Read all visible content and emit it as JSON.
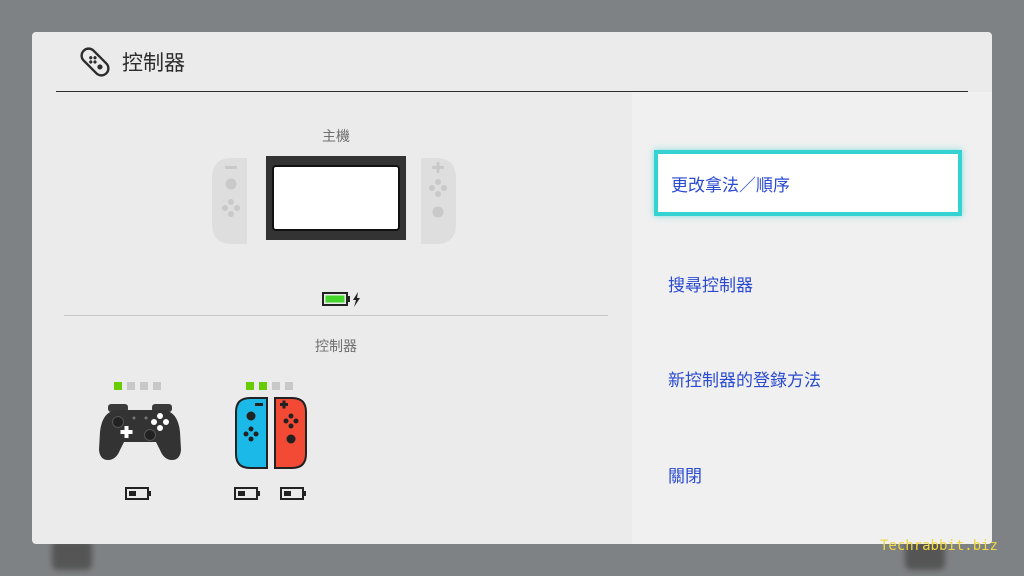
{
  "header": {
    "title": "控制器",
    "icon": "joycon-icon"
  },
  "console_section": {
    "label": "主機",
    "battery": "charging"
  },
  "controllers_section": {
    "label": "控制器",
    "pro_controller": {
      "player_lights": [
        true,
        false,
        false,
        false
      ]
    },
    "joycon_pair": {
      "player_lights": [
        true,
        true,
        false,
        false
      ],
      "left_color": "#1ab9e8",
      "right_color": "#f34a36"
    }
  },
  "menu": {
    "items": [
      {
        "label": "更改拿法／順序",
        "selected": true
      },
      {
        "label": "搜尋控制器",
        "selected": false
      },
      {
        "label": "新控制器的登錄方法",
        "selected": false
      },
      {
        "label": "關閉",
        "selected": false
      }
    ]
  },
  "watermark": "Techrabbit.biz",
  "colors": {
    "accent_selection": "#34d2d0",
    "menu_text": "#2a4ad0",
    "battery_green": "#44d62c",
    "player_light_on": "#66cc00"
  }
}
